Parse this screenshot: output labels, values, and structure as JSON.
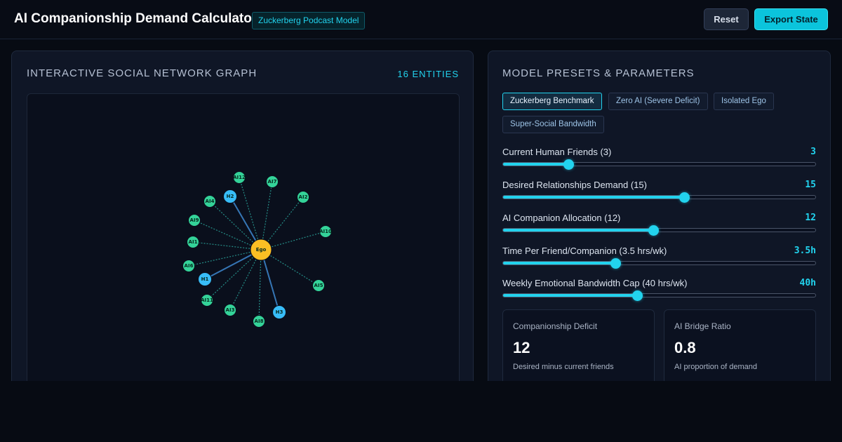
{
  "header": {
    "title": "AI Companionship Demand Calculator",
    "badge": "Zuckerberg Podcast Model",
    "reset_label": "Reset",
    "export_label": "Export State"
  },
  "graph_panel": {
    "title": "INTERACTIVE SOCIAL NETWORK GRAPH",
    "entity_count": "16 ENTITIES",
    "center_node": "Ego",
    "nodes": [
      {
        "label": "AI12",
        "kind": "ai"
      },
      {
        "label": "AI7",
        "kind": "ai"
      },
      {
        "label": "AI2",
        "kind": "ai"
      },
      {
        "label": "H2",
        "kind": "human"
      },
      {
        "label": "AI4",
        "kind": "ai"
      },
      {
        "label": "AI9",
        "kind": "ai"
      },
      {
        "label": "AI10",
        "kind": "ai"
      },
      {
        "label": "AI1",
        "kind": "ai"
      },
      {
        "label": "AI6",
        "kind": "ai"
      },
      {
        "label": "H1",
        "kind": "human"
      },
      {
        "label": "AI5",
        "kind": "ai"
      },
      {
        "label": "AI11",
        "kind": "ai"
      },
      {
        "label": "AI3",
        "kind": "ai"
      },
      {
        "label": "H3",
        "kind": "human"
      },
      {
        "label": "AI8",
        "kind": "ai"
      }
    ],
    "colors": {
      "ego": "#fbbf24",
      "human": "#38bdf8",
      "ai": "#34d399"
    }
  },
  "params_panel": {
    "title": "MODEL PRESETS & PARAMETERS",
    "presets": [
      {
        "label": "Zuckerberg Benchmark",
        "active": true
      },
      {
        "label": "Zero AI (Severe Deficit)",
        "active": false
      },
      {
        "label": "Isolated Ego",
        "active": false
      },
      {
        "label": "Super-Social Bandwidth",
        "active": false
      }
    ],
    "sliders": [
      {
        "label": "Current Human Friends (3)",
        "value": "3",
        "level": 0.21
      },
      {
        "label": "Desired Relationships Demand (15)",
        "value": "15",
        "level": 0.58
      },
      {
        "label": "AI Companion Allocation (12)",
        "value": "12",
        "level": 0.48
      },
      {
        "label": "Time Per Friend/Companion (3.5 hrs/wk)",
        "value": "3.5h",
        "level": 0.36
      },
      {
        "label": "Weekly Emotional Bandwidth Cap (40 hrs/wk)",
        "value": "40h",
        "level": 0.43
      }
    ],
    "stats": [
      {
        "label": "Companionship Deficit",
        "value": "12",
        "sub": "Desired minus current friends"
      },
      {
        "label": "AI Bridge Ratio",
        "value": "0.8",
        "sub": "AI proportion of demand"
      }
    ]
  }
}
